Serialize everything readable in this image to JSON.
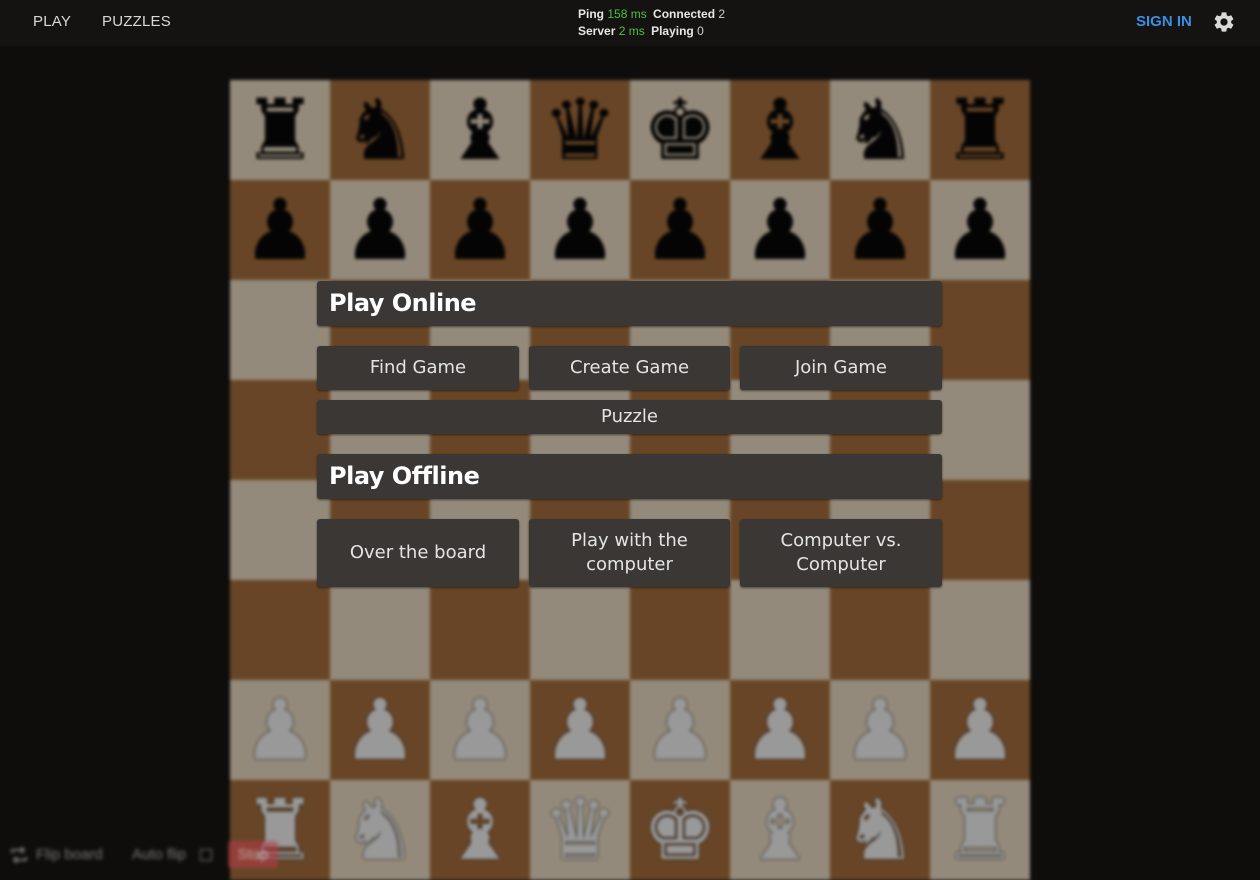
{
  "nav": {
    "play": "PLAY",
    "puzzles": "PUZZLES",
    "sign_in": "SIGN IN"
  },
  "stats": {
    "ping_label": "Ping",
    "ping_value": "158 ms",
    "connected_label": "Connected",
    "connected_value": "2",
    "server_label": "Server",
    "server_value": "2 ms",
    "playing_label": "Playing",
    "playing_value": "0"
  },
  "board": {
    "light_color": "#efdfc6",
    "dark_color": "#a8703d",
    "ranks": [
      [
        "♜",
        "♞",
        "♝",
        "♛",
        "♚",
        "♝",
        "♞",
        "♜"
      ],
      [
        "♟",
        "♟",
        "♟",
        "♟",
        "♟",
        "♟",
        "♟",
        "♟"
      ],
      [
        "",
        "",
        "",
        "",
        "",
        "",
        "",
        ""
      ],
      [
        "",
        "",
        "",
        "",
        "",
        "",
        "",
        ""
      ],
      [
        "",
        "",
        "",
        "",
        "",
        "",
        "",
        ""
      ],
      [
        "",
        "",
        "",
        "",
        "",
        "",
        "",
        ""
      ],
      [
        "♟",
        "♟",
        "♟",
        "♟",
        "♟",
        "♟",
        "♟",
        "♟"
      ],
      [
        "♜",
        "♞",
        "♝",
        "♛",
        "♚",
        "♝",
        "♞",
        "♜"
      ]
    ],
    "piece_colors": [
      "black",
      "black",
      "",
      "",
      "",
      "",
      "white",
      "white"
    ]
  },
  "menu": {
    "online_title": "Play Online",
    "find_game": "Find Game",
    "create_game": "Create Game",
    "join_game": "Join Game",
    "puzzle": "Puzzle",
    "offline_title": "Play Offline",
    "over_the_board": "Over the board",
    "play_with_computer": "Play with the computer",
    "computer_vs_computer": "Computer vs. Computer"
  },
  "toolbar": {
    "flip_board": "Flip board",
    "auto_flip": "Auto flip",
    "stop": "Stop"
  },
  "colors": {
    "accent": "#3a8fe3",
    "ok": "#4fbf3f",
    "button_bg": "#3a3734",
    "stop_bg": "#b83b49"
  }
}
